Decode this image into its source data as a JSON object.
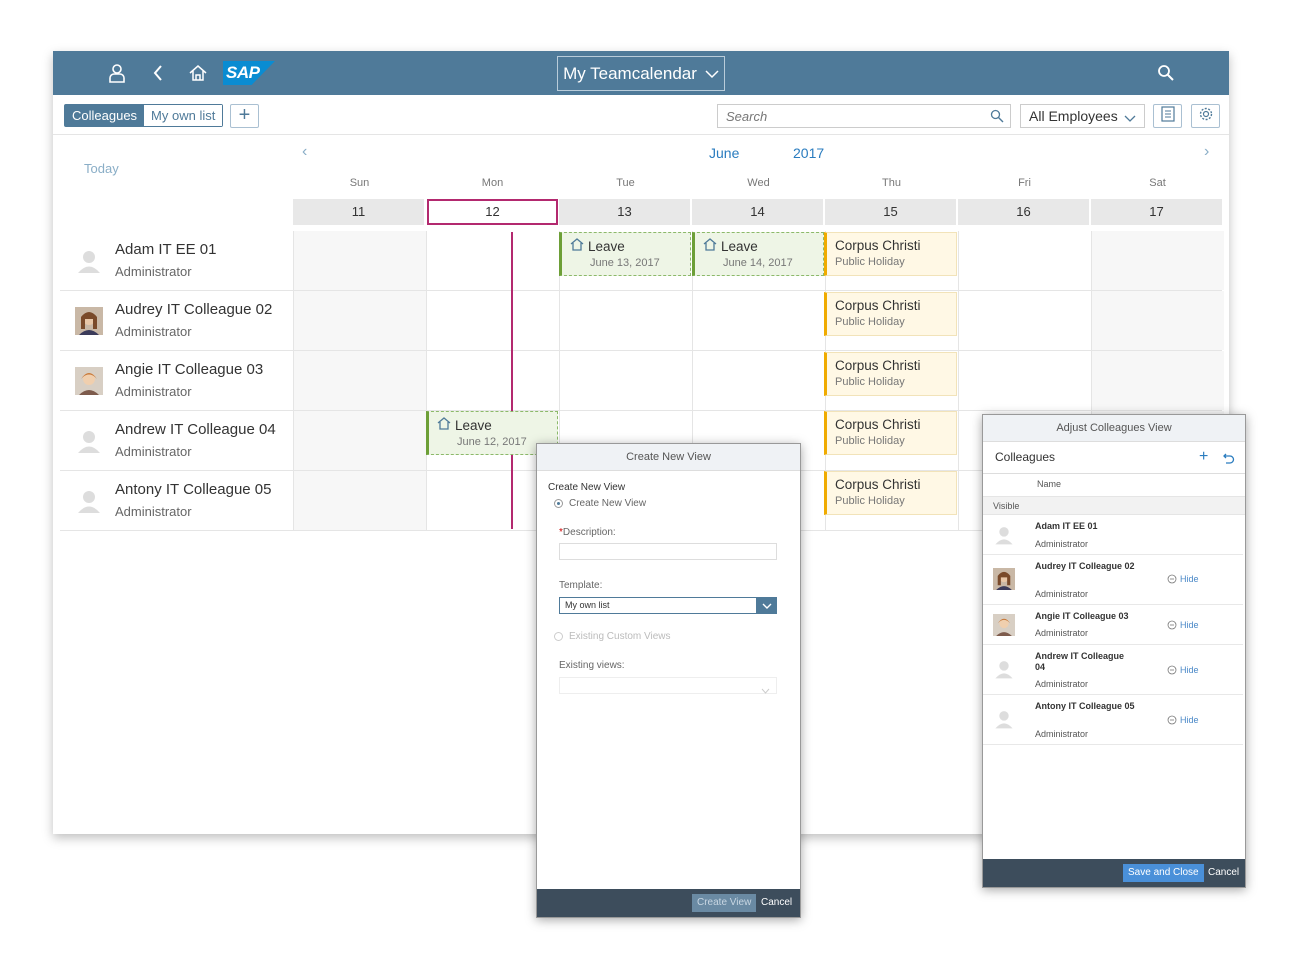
{
  "shell": {
    "title": "My Teamcalendar",
    "logo_text": "SAP",
    "icons": [
      "user-icon",
      "back-icon",
      "home-icon",
      "search-icon"
    ]
  },
  "toolbar": {
    "segments": [
      "Colleagues",
      "My own list"
    ],
    "search_placeholder": "Search",
    "filter_value": "All Employees"
  },
  "calendar": {
    "today_label": "Today",
    "month": "June",
    "year": "2017",
    "days": [
      {
        "name": "Sun",
        "date": "11"
      },
      {
        "name": "Mon",
        "date": "12"
      },
      {
        "name": "Tue",
        "date": "13"
      },
      {
        "name": "Wed",
        "date": "14"
      },
      {
        "name": "Thu",
        "date": "15"
      },
      {
        "name": "Fri",
        "date": "16"
      },
      {
        "name": "Sat",
        "date": "17"
      }
    ],
    "rows": [
      {
        "name": "Adam IT EE 01",
        "role": "Administrator"
      },
      {
        "name": "Audrey IT Colleague 02",
        "role": "Administrator"
      },
      {
        "name": "Angie IT Colleague 03",
        "role": "Administrator"
      },
      {
        "name": "Andrew IT Colleague 04",
        "role": "Administrator"
      },
      {
        "name": "Antony IT Colleague 05",
        "role": "Administrator"
      }
    ],
    "leave1": {
      "title": "Leave",
      "date": "June 13, 2017"
    },
    "leave2": {
      "title": "Leave",
      "date": "June 14, 2017"
    },
    "leave3": {
      "title": "Leave",
      "date": "June 12, 2017"
    },
    "holiday": {
      "title": "Corpus Christi",
      "subtitle": "Public Holiday"
    }
  },
  "create_dialog": {
    "title": "Create New View",
    "section_label": "Create New View",
    "radio1": "Create New View",
    "description_label": "Description:",
    "required_mark": "*",
    "template_label": "Template:",
    "template_value": "My own list",
    "radio2": "Existing Custom Views",
    "existing_label": "Existing views:",
    "create_btn": "Create View",
    "cancel_btn": "Cancel"
  },
  "adjust_dialog": {
    "title": "Adjust Colleagues View",
    "list_title": "Colleagues",
    "col_name": "Name",
    "group_label": "Visible",
    "hide_label": "Hide",
    "items": [
      {
        "name": "Adam IT EE 01",
        "role": "Administrator"
      },
      {
        "name": "Audrey IT Colleague 02",
        "role": "Administrator"
      },
      {
        "name": "Angie IT Colleague 03",
        "role": "Administrator"
      },
      {
        "name": "Andrew IT Colleague 04",
        "role": "Administrator"
      },
      {
        "name": "Antony IT Colleague 05",
        "role": "Administrator"
      }
    ],
    "save_btn": "Save and Close",
    "cancel_btn": "Cancel"
  },
  "colors": {
    "shell": "#4f7a99",
    "today_marker": "#b3296f",
    "leave": "#6d9f37",
    "holiday": "#f0ab00",
    "footer": "#3d4d5c"
  }
}
